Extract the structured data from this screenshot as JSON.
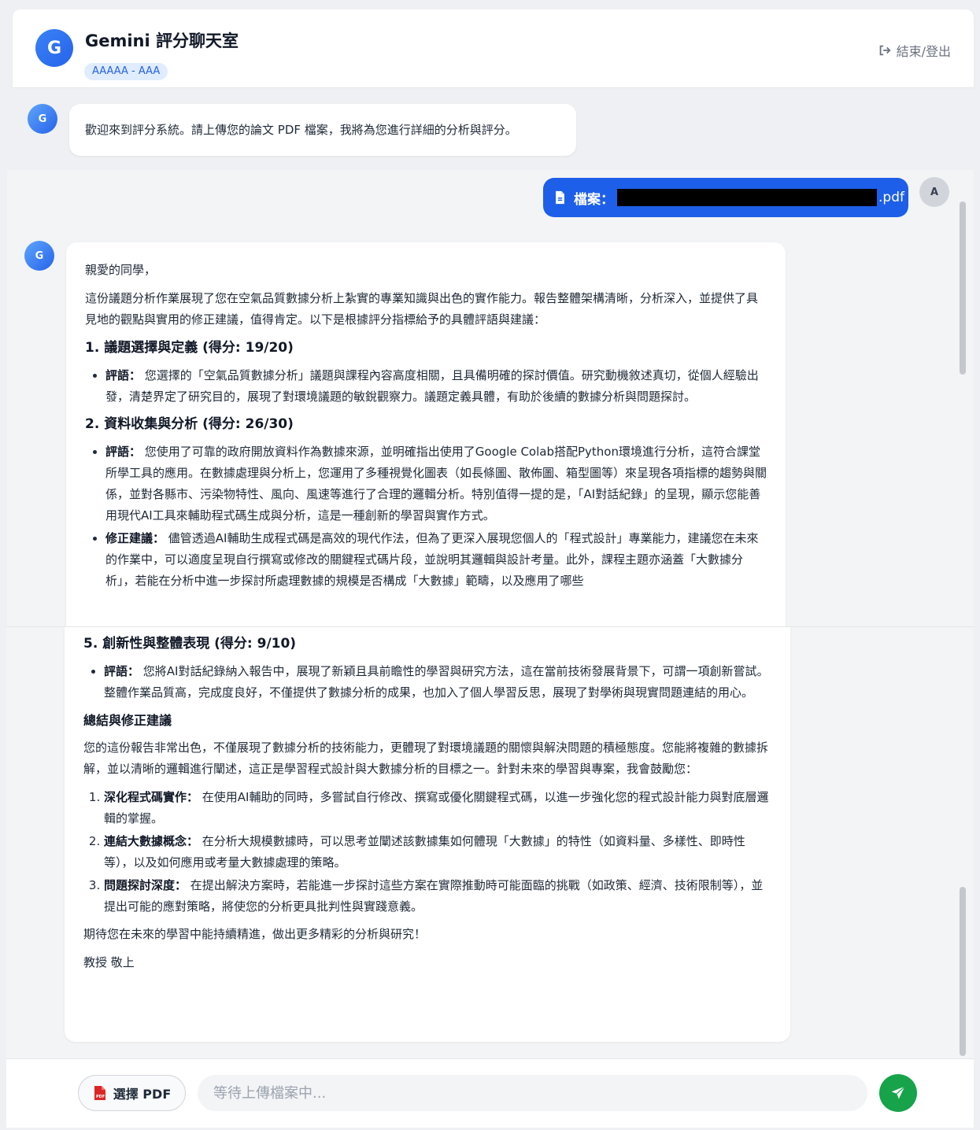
{
  "header": {
    "logo_letter": "G",
    "title": "Gemini 評分聊天室",
    "badge": "AAAAA - AAA",
    "logout_label": "結束/登出"
  },
  "messages": {
    "bot_avatar": "G",
    "user_avatar": "A",
    "welcome": "歡迎來到評分系統。請上傳您的論文 PDF 檔案，我將為您進行詳細的分析與評分。",
    "file_prefix": "檔案：",
    "file_ext": ".pdf"
  },
  "reply_top": {
    "greeting": "親愛的同學，",
    "intro": "這份議題分析作業展現了您在空氣品質數據分析上紮實的專業知識與出色的實作能力。報告整體架構清晰，分析深入，並提供了具見地的觀點與實用的修正建議，值得肯定。以下是根據評分指標給予的具體評語與建議：",
    "s1_title": "1. 議題選擇與定義 (得分: 19/20)",
    "s1_c1_label": "評語：",
    "s1_c1_text": "您選擇的「空氣品質數據分析」議題與課程內容高度相關，且具備明確的探討價值。研究動機敘述真切，從個人經驗出發，清楚界定了研究目的，展現了對環境議題的敏銳觀察力。議題定義具體，有助於後續的數據分析與問題探討。",
    "s2_title": "2. 資料收集與分析 (得分: 26/30)",
    "s2_c1_label": "評語：",
    "s2_c1_text": "您使用了可靠的政府開放資料作為數據來源，並明確指出使用了Google Colab搭配Python環境進行分析，這符合課堂所學工具的應用。在數據處理與分析上，您運用了多種視覺化圖表（如長條圖、散佈圖、箱型圖等）來呈現各項指標的趨勢與關係，並對各縣市、污染物特性、風向、風速等進行了合理的邏輯分析。特別值得一提的是，「AI對話紀錄」的呈現，顯示您能善用現代AI工具來輔助程式碼生成與分析，這是一種創新的學習與實作方式。",
    "s2_c2_label": "修正建議：",
    "s2_c2_text": "儘管透過AI輔助生成程式碼是高效的現代作法，但為了更深入展現您個人的「程式設計」專業能力，建議您在未來的作業中，可以適度呈現自行撰寫或修改的關鍵程式碼片段，並說明其邏輯與設計考量。此外，課程主題亦涵蓋「大數據分析」，若能在分析中進一步探討所處理數據的規模是否構成「大數據」範疇，以及應用了哪些"
  },
  "reply_bottom": {
    "s5_title": "5. 創新性與整體表現 (得分: 9/10)",
    "s5_c1_label": "評語：",
    "s5_c1_text": "您將AI對話紀錄納入報告中，展現了新穎且具前瞻性的學習與研究方法，這在當前技術發展背景下，可謂一項創新嘗試。整體作業品質高，完成度良好，不僅提供了數據分析的成果，也加入了個人學習反思，展現了對學術與現實問題連結的用心。",
    "summary_title": "總結與修正建議",
    "summary_text": "您的這份報告非常出色，不僅展現了數據分析的技術能力，更體現了對環境議題的關懷與解決問題的積極態度。您能將複雜的數據拆解，並以清晰的邏輯進行闡述，這正是學習程式設計與大數據分析的目標之一。針對未來的學習與專案，我會鼓勵您：",
    "items": [
      {
        "label": "深化程式碼實作：",
        "text": "在使用AI輔助的同時，多嘗試自行修改、撰寫或優化關鍵程式碼，以進一步強化您的程式設計能力與對底層邏輯的掌握。"
      },
      {
        "label": "連結大數據概念：",
        "text": "在分析大規模數據時，可以思考並闡述該數據集如何體現「大數據」的特性（如資料量、多樣性、即時性等），以及如何應用或考量大數據處理的策略。"
      },
      {
        "label": "問題探討深度：",
        "text": "在提出解決方案時，若能進一步探討這些方案在實際推動時可能面臨的挑戰（如政策、經濟、技術限制等），並提出可能的應對策略，將使您的分析更具批判性與實踐意義。"
      }
    ],
    "closing": "期待您在未來的學習中能持續精進，做出更多精彩的分析與研究！",
    "signature": "教授 敬上"
  },
  "input": {
    "pdf_button_label": "選擇 PDF",
    "placeholder": "等待上傳檔案中..."
  },
  "colors": {
    "accent": "#2563eb",
    "send": "#16a34a",
    "pdf_icon": "#dc2626"
  }
}
